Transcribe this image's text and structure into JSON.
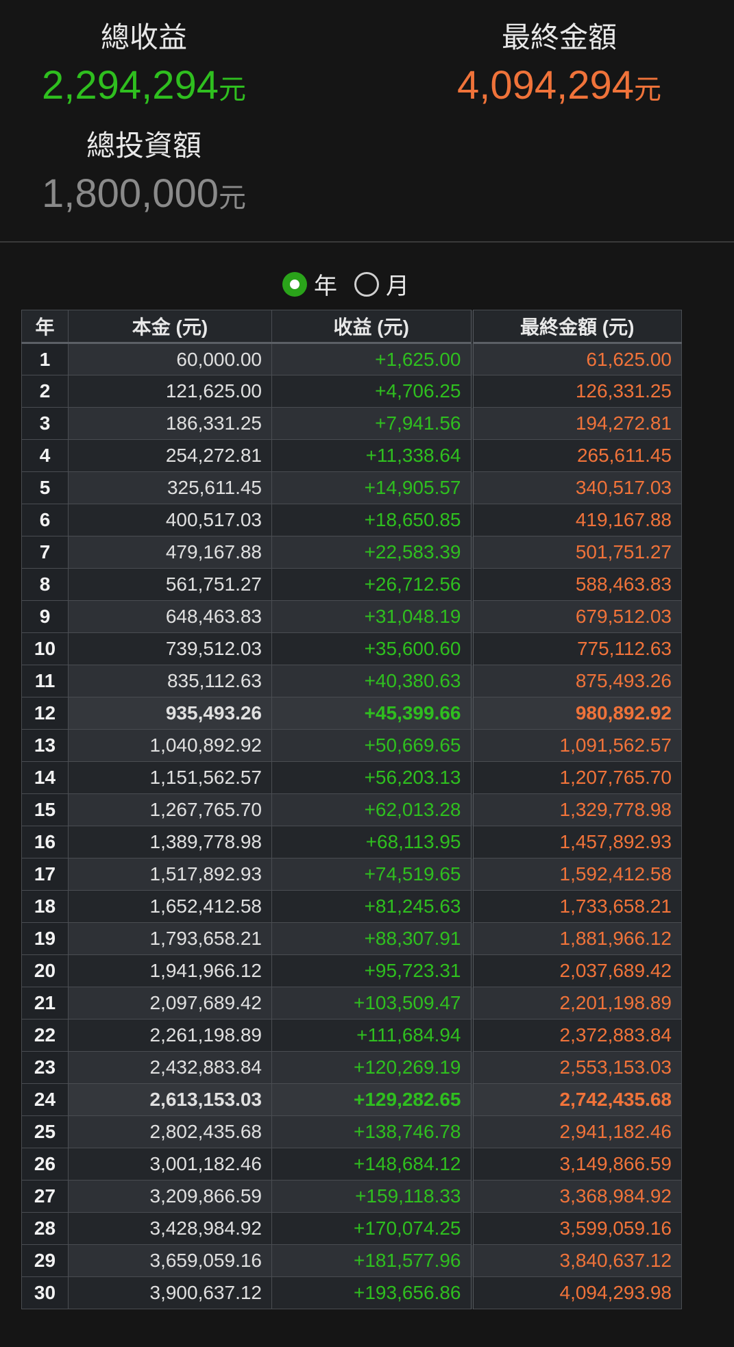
{
  "summary": {
    "total_gain": {
      "label": "總收益",
      "value": "2,294,294",
      "unit": "元"
    },
    "final_amount": {
      "label": "最終金額",
      "value": "4,094,294",
      "unit": "元"
    },
    "total_invested": {
      "label": "總投資額",
      "value": "1,800,000",
      "unit": "元"
    }
  },
  "period_toggle": {
    "options": [
      {
        "label": "年",
        "selected": true
      },
      {
        "label": "月",
        "selected": false
      }
    ]
  },
  "table": {
    "headers": [
      "年",
      "本金 (元)",
      "收益 (元)",
      "最終金額 (元)"
    ],
    "rows": [
      {
        "year": "1",
        "principal": "60,000.00",
        "gain": "+1,625.00",
        "final": "61,625.00"
      },
      {
        "year": "2",
        "principal": "121,625.00",
        "gain": "+4,706.25",
        "final": "126,331.25"
      },
      {
        "year": "3",
        "principal": "186,331.25",
        "gain": "+7,941.56",
        "final": "194,272.81"
      },
      {
        "year": "4",
        "principal": "254,272.81",
        "gain": "+11,338.64",
        "final": "265,611.45"
      },
      {
        "year": "5",
        "principal": "325,611.45",
        "gain": "+14,905.57",
        "final": "340,517.03"
      },
      {
        "year": "6",
        "principal": "400,517.03",
        "gain": "+18,650.85",
        "final": "419,167.88"
      },
      {
        "year": "7",
        "principal": "479,167.88",
        "gain": "+22,583.39",
        "final": "501,751.27"
      },
      {
        "year": "8",
        "principal": "561,751.27",
        "gain": "+26,712.56",
        "final": "588,463.83"
      },
      {
        "year": "9",
        "principal": "648,463.83",
        "gain": "+31,048.19",
        "final": "679,512.03"
      },
      {
        "year": "10",
        "principal": "739,512.03",
        "gain": "+35,600.60",
        "final": "775,112.63"
      },
      {
        "year": "11",
        "principal": "835,112.63",
        "gain": "+40,380.63",
        "final": "875,493.26"
      },
      {
        "year": "12",
        "principal": "935,493.26",
        "gain": "+45,399.66",
        "final": "980,892.92",
        "bold": true
      },
      {
        "year": "13",
        "principal": "1,040,892.92",
        "gain": "+50,669.65",
        "final": "1,091,562.57"
      },
      {
        "year": "14",
        "principal": "1,151,562.57",
        "gain": "+56,203.13",
        "final": "1,207,765.70"
      },
      {
        "year": "15",
        "principal": "1,267,765.70",
        "gain": "+62,013.28",
        "final": "1,329,778.98"
      },
      {
        "year": "16",
        "principal": "1,389,778.98",
        "gain": "+68,113.95",
        "final": "1,457,892.93"
      },
      {
        "year": "17",
        "principal": "1,517,892.93",
        "gain": "+74,519.65",
        "final": "1,592,412.58"
      },
      {
        "year": "18",
        "principal": "1,652,412.58",
        "gain": "+81,245.63",
        "final": "1,733,658.21"
      },
      {
        "year": "19",
        "principal": "1,793,658.21",
        "gain": "+88,307.91",
        "final": "1,881,966.12"
      },
      {
        "year": "20",
        "principal": "1,941,966.12",
        "gain": "+95,723.31",
        "final": "2,037,689.42"
      },
      {
        "year": "21",
        "principal": "2,097,689.42",
        "gain": "+103,509.47",
        "final": "2,201,198.89"
      },
      {
        "year": "22",
        "principal": "2,261,198.89",
        "gain": "+111,684.94",
        "final": "2,372,883.84"
      },
      {
        "year": "23",
        "principal": "2,432,883.84",
        "gain": "+120,269.19",
        "final": "2,553,153.03"
      },
      {
        "year": "24",
        "principal": "2,613,153.03",
        "gain": "+129,282.65",
        "final": "2,742,435.68",
        "bold": true
      },
      {
        "year": "25",
        "principal": "2,802,435.68",
        "gain": "+138,746.78",
        "final": "2,941,182.46"
      },
      {
        "year": "26",
        "principal": "3,001,182.46",
        "gain": "+148,684.12",
        "final": "3,149,866.59"
      },
      {
        "year": "27",
        "principal": "3,209,866.59",
        "gain": "+159,118.33",
        "final": "3,368,984.92"
      },
      {
        "year": "28",
        "principal": "3,428,984.92",
        "gain": "+170,074.25",
        "final": "3,599,059.16"
      },
      {
        "year": "29",
        "principal": "3,659,059.16",
        "gain": "+181,577.96",
        "final": "3,840,637.12"
      },
      {
        "year": "30",
        "principal": "3,900,637.12",
        "gain": "+193,656.86",
        "final": "4,094,293.98"
      }
    ]
  },
  "colors": {
    "gain": "#2fbf1f",
    "final": "#f0733a",
    "invested": "#8a8a8a",
    "background": "#151515",
    "radio_selected": "#2aa31a"
  }
}
